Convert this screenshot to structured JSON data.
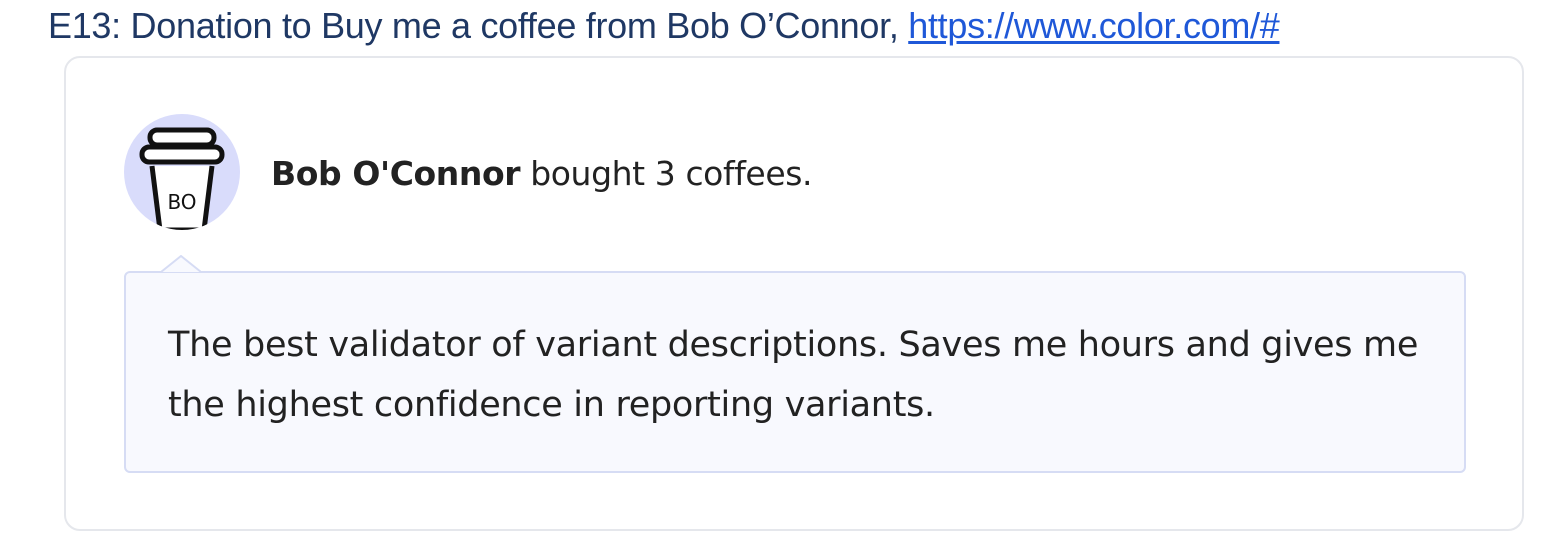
{
  "heading": {
    "text": "E13: Donation to Buy me a coffee from Bob O’Connor, ",
    "link_text": "https://www.color.com/#"
  },
  "donation": {
    "avatar_initials": "BO",
    "avatar_icon": "coffee-cup-icon",
    "donor_name": "Bob O'Connor",
    "action_text": " bought 3 coffees.",
    "message": "The best validator of variant descriptions. Saves me hours and gives me the highest confidence in reporting variants."
  },
  "colors": {
    "heading": "#1f3864",
    "link": "#1f58d8",
    "avatar_bg": "#d9dcfb",
    "bubble_bg": "#f8f9fe",
    "bubble_border": "#d6dcf4",
    "card_border": "#e5e7ec"
  }
}
